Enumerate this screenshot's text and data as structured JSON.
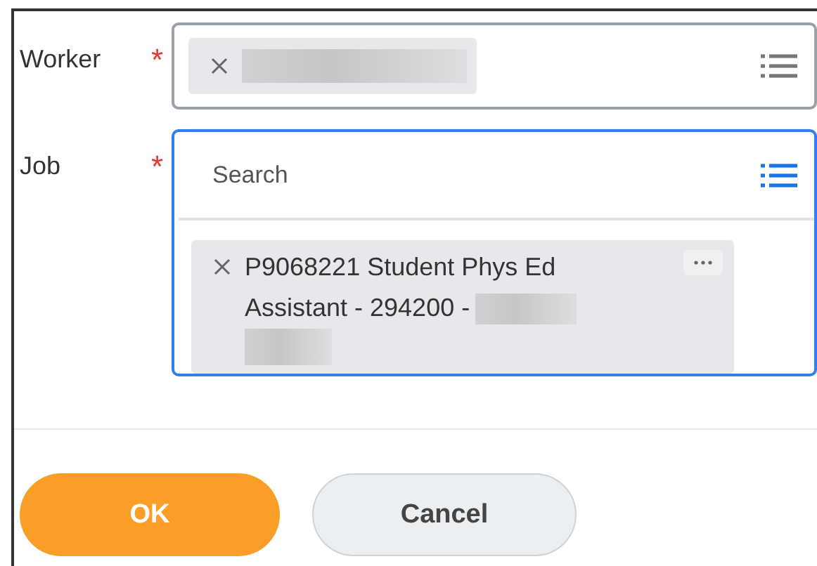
{
  "fields": [
    {
      "label": "Worker",
      "required_mark": "*",
      "focused": false,
      "selection": {
        "redactions": [
          {
            "kind": "wide"
          }
        ]
      }
    },
    {
      "label": "Job",
      "required_mark": "*",
      "focused": true,
      "placeholder": "Search",
      "selection": {
        "text_lines": [
          "P9068221 Student Phys Ed",
          "Assistant - 294200 -"
        ],
        "redactions": [
          {
            "kind": "inline"
          },
          {
            "kind": "block"
          }
        ]
      }
    }
  ],
  "buttons": [
    {
      "label": "OK",
      "kind": "primary"
    },
    {
      "label": "Cancel",
      "kind": "secondary"
    }
  ]
}
